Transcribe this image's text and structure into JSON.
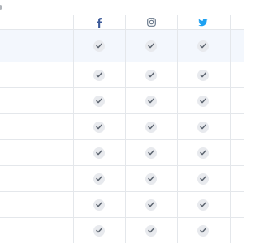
{
  "header": {
    "networks": [
      {
        "icon": "facebook-icon",
        "color": "#3b5998"
      },
      {
        "icon": "instagram-icon",
        "color": "#6b7a8c"
      },
      {
        "icon": "twitter-icon",
        "color": "#1da1f2"
      }
    ]
  },
  "rows": [
    {
      "highlighted": true,
      "facebook": true,
      "instagram": true,
      "twitter": true
    },
    {
      "highlighted": false,
      "facebook": true,
      "instagram": true,
      "twitter": true
    },
    {
      "highlighted": false,
      "facebook": true,
      "instagram": true,
      "twitter": true
    },
    {
      "highlighted": false,
      "facebook": true,
      "instagram": true,
      "twitter": true
    },
    {
      "highlighted": false,
      "facebook": true,
      "instagram": true,
      "twitter": true
    },
    {
      "highlighted": false,
      "facebook": true,
      "instagram": true,
      "twitter": true
    },
    {
      "highlighted": false,
      "facebook": true,
      "instagram": true,
      "twitter": true
    },
    {
      "highlighted": false,
      "facebook": true,
      "instagram": true,
      "twitter": true
    }
  ],
  "colors": {
    "check_bg": "#e8eaee",
    "check_mark": "#5d6570",
    "highlight_row": "#f3f7fd",
    "border": "#e4e7eb"
  }
}
